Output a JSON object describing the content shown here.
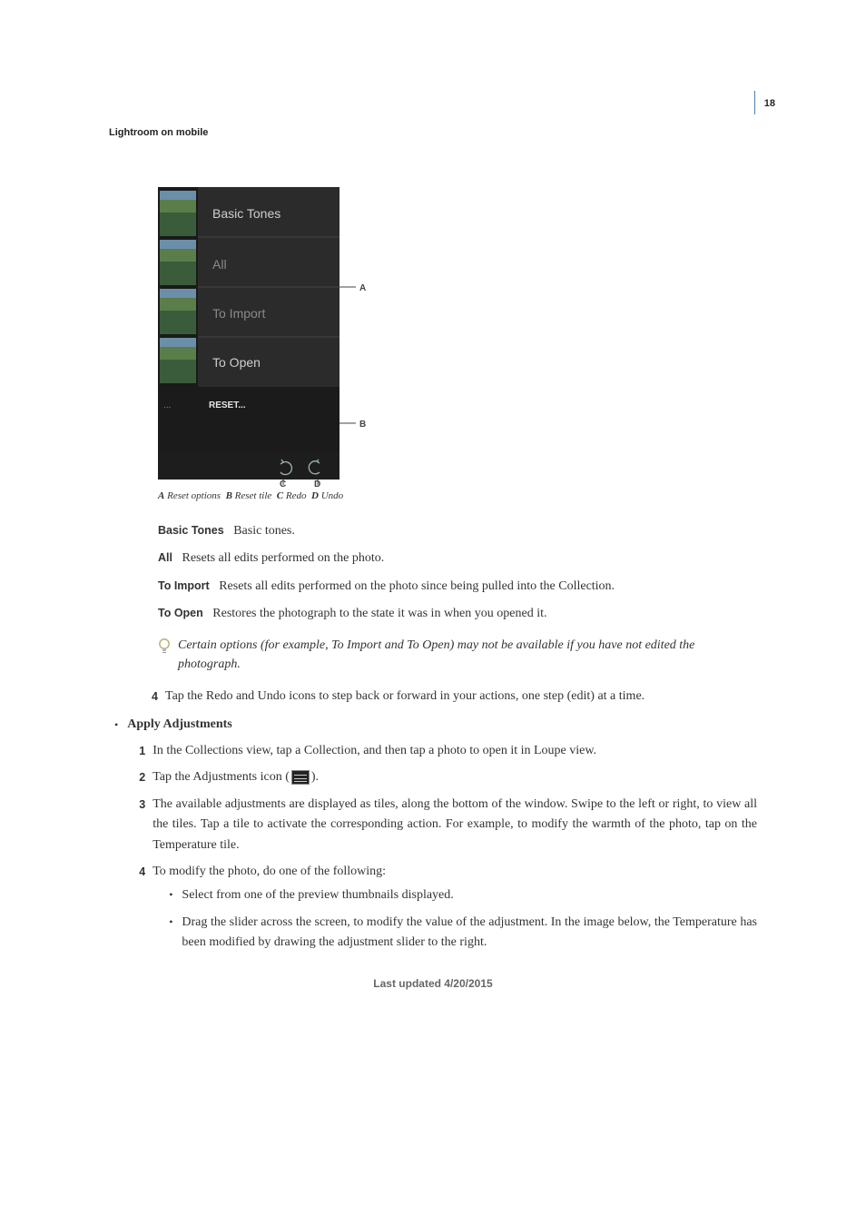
{
  "page_number": "18",
  "running_header": "Lightroom on mobile",
  "figure": {
    "menu_items": [
      "Basic Tones",
      "All",
      "To Import",
      "To Open"
    ],
    "reset_label": "RESET...",
    "callouts": {
      "a": "A",
      "b": "B",
      "c": "C",
      "d": "D"
    }
  },
  "caption": {
    "a_key": "A",
    "a_text": "Reset options",
    "b_key": "B",
    "b_text": "Reset tile",
    "c_key": "C",
    "c_text": "Redo",
    "d_key": "D",
    "d_text": "Undo"
  },
  "defs": [
    {
      "term": "Basic Tones",
      "desc": "Basic tones."
    },
    {
      "term": "All",
      "desc": "Resets all edits performed on the photo."
    },
    {
      "term": "To Import",
      "desc": "Resets all edits performed on the photo since being pulled into the Collection."
    },
    {
      "term": "To Open",
      "desc": "Restores the photograph to the state it was in when you opened it."
    }
  ],
  "tip_text": "Certain options (for example, To Import and To Open) may not be available if you have not edited the photograph.",
  "step4": {
    "n": "4",
    "text": "Tap the Redo and Undo icons to step back or forward in your actions, one step (edit) at a time."
  },
  "apply_section_title": "Apply Adjustments",
  "apply_steps": {
    "1": {
      "n": "1",
      "text": "In the Collections view, tap a Collection, and then tap a photo to open it in Loupe view."
    },
    "2": {
      "n": "2",
      "prefix": "Tap the Adjustments icon (",
      "suffix": ")."
    },
    "3": {
      "n": "3",
      "text": "The available adjustments are displayed as tiles, along the bottom of the window. Swipe to the left or right, to view all the tiles. Tap a tile to activate the corresponding action. For example, to modify the warmth of the photo, tap on the Temperature tile."
    },
    "4": {
      "n": "4",
      "text": "To modify the photo, do one of the following:"
    }
  },
  "sub_bullets": [
    "Select from one of the preview thumbnails displayed.",
    "Drag the slider across the screen, to modify the value of the adjustment. In the image below, the Temperature has been modified by drawing the adjustment slider to the right."
  ],
  "footer": "Last updated 4/20/2015"
}
